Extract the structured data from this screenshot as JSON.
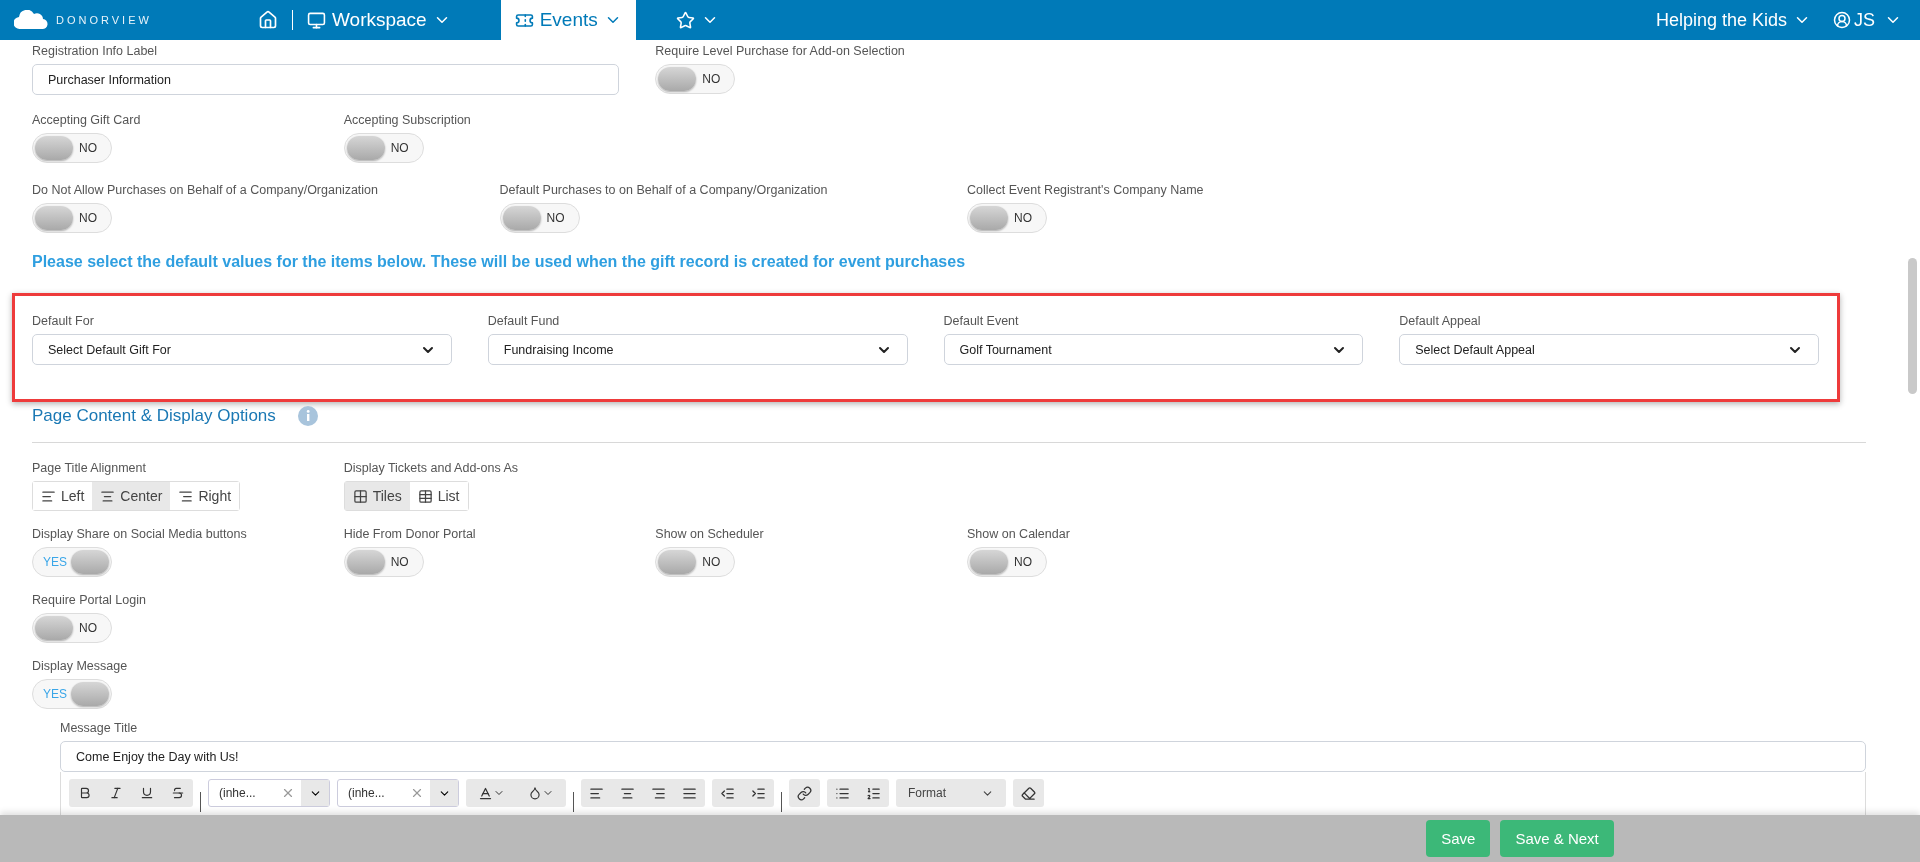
{
  "header": {
    "brand": "DONORVIEW",
    "nav": [
      {
        "label": "Workspace",
        "kind": "workspace",
        "selected": false
      },
      {
        "label": "Events",
        "kind": "events",
        "selected": true
      }
    ],
    "org": "Helping the Kids",
    "user": "JS"
  },
  "registration": {
    "label": "Registration Info Label",
    "value": "Purchaser Information"
  },
  "require_level": {
    "label": "Require Level Purchase for Add-on Selection",
    "on": false,
    "text": "NO"
  },
  "accepting": [
    {
      "label": "Accepting Gift Card",
      "on": false,
      "text": "NO"
    },
    {
      "label": "Accepting Subscription",
      "on": false,
      "text": "NO"
    }
  ],
  "purchases": [
    {
      "label": "Do Not Allow Purchases on Behalf of a Company/Organization",
      "on": false,
      "text": "NO"
    },
    {
      "label": "Default Purchases to on Behalf of a Company/Organization",
      "on": false,
      "text": "NO"
    },
    {
      "label": "Collect Event Registrant's Company Name",
      "on": false,
      "text": "NO"
    }
  ],
  "defaults_note": "Please select the default values for the items below. These will be used when the gift record is created for event purchases",
  "defaults": [
    {
      "label": "Default For",
      "value": "Select Default Gift For"
    },
    {
      "label": "Default Fund",
      "value": "Fundraising Income"
    },
    {
      "label": "Default Event",
      "value": "Golf Tournament"
    },
    {
      "label": "Default Appeal",
      "value": "Select Default Appeal"
    }
  ],
  "page_content": {
    "title": "Page Content & Display Options",
    "alignment": {
      "label": "Page Title Alignment",
      "options": [
        {
          "label": "Left",
          "kind": "left",
          "selected": false
        },
        {
          "label": "Center",
          "kind": "center",
          "selected": true
        },
        {
          "label": "Right",
          "kind": "right",
          "selected": false
        }
      ]
    },
    "display_as": {
      "label": "Display Tickets and Add-ons As",
      "options": [
        {
          "label": "Tiles",
          "kind": "tiles",
          "selected": true
        },
        {
          "label": "List",
          "kind": "list",
          "selected": false
        }
      ]
    },
    "toggles": [
      {
        "label": "Display Share on Social Media buttons",
        "on": true,
        "text": "YES"
      },
      {
        "label": "Hide From Donor Portal",
        "on": false,
        "text": "NO"
      },
      {
        "label": "Show on Scheduler",
        "on": false,
        "text": "NO"
      },
      {
        "label": "Show on Calendar",
        "on": false,
        "text": "NO"
      }
    ],
    "require_login": {
      "label": "Require Portal Login",
      "on": false,
      "text": "NO"
    },
    "display_message": {
      "label": "Display Message",
      "on": true,
      "text": "YES"
    },
    "message_title": {
      "label": "Message Title",
      "value": "Come Enjoy the Day with Us!"
    },
    "editor": {
      "font_name": "(inhe...",
      "font_size": "(inhe...",
      "format": "Format"
    }
  },
  "footer": {
    "buttons": [
      "Save",
      "Save & Next"
    ]
  }
}
